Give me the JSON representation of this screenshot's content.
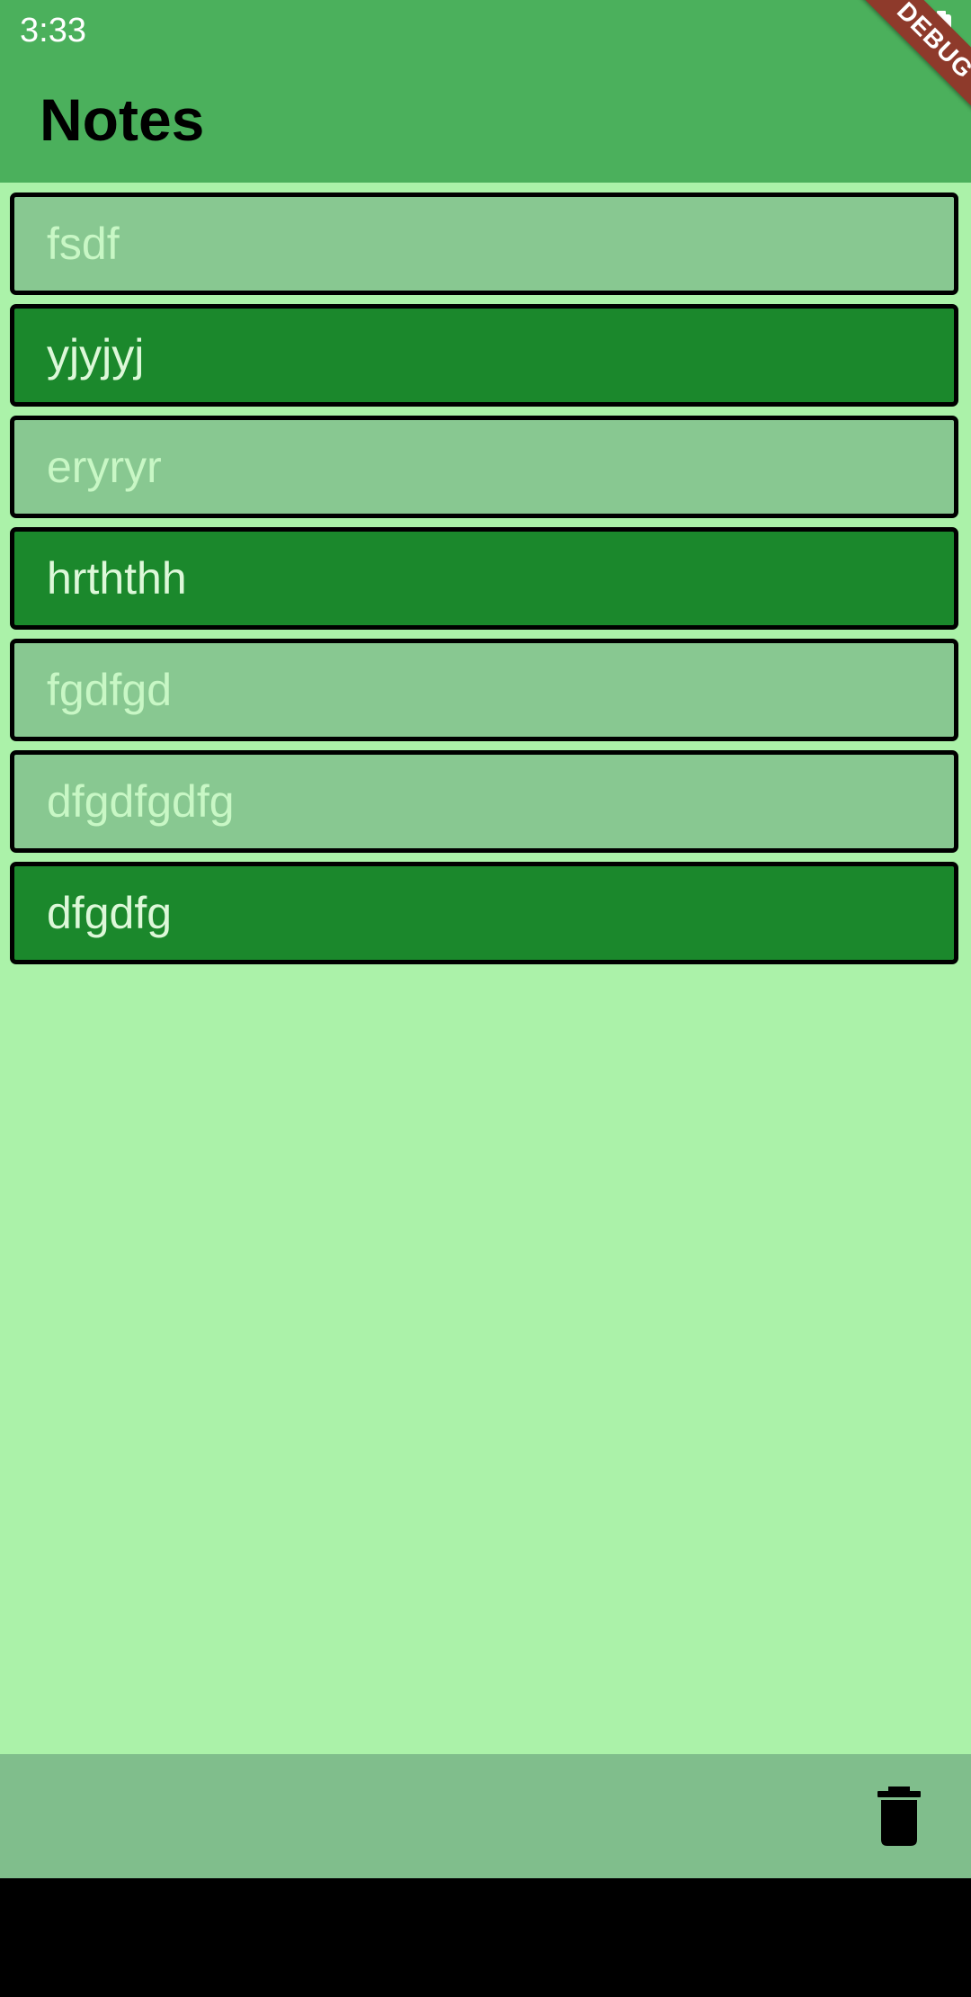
{
  "status_bar": {
    "time": "3:33"
  },
  "app_bar": {
    "title": "Notes"
  },
  "debug_banner": {
    "label": "DEBUG"
  },
  "notes": [
    {
      "text": "fsdf",
      "style": "light"
    },
    {
      "text": "yjyjyj",
      "style": "dark"
    },
    {
      "text": "eryryr",
      "style": "light"
    },
    {
      "text": "hrththh",
      "style": "dark"
    },
    {
      "text": "fgdfgd",
      "style": "light"
    },
    {
      "text": "dfgdfgdfg",
      "style": "light"
    },
    {
      "text": "dfgdfg",
      "style": "dark"
    }
  ],
  "bottom_bar": {
    "action_icon": "trash-icon"
  },
  "colors": {
    "app_bar": "#4bb05c",
    "background": "#abf2a9",
    "note_light": "#88c891",
    "note_dark": "#1b882c",
    "bottom_bar": "#80be8c",
    "debug_ribbon": "#8e3a2b"
  }
}
